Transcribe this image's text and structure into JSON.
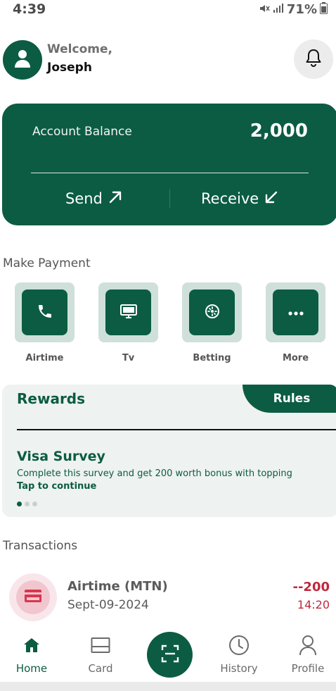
{
  "status_bar": {
    "time": "4:39",
    "battery": "71%"
  },
  "header": {
    "welcome": "Welcome,",
    "user_name": "Joseph"
  },
  "balance_card": {
    "label": "Account Balance",
    "value": "2,000",
    "send_label": "Send",
    "receive_label": "Receive"
  },
  "make_payment": {
    "title": "Make Payment",
    "items": [
      {
        "label": "Airtime",
        "icon": "phone-icon"
      },
      {
        "label": "Tv",
        "icon": "tv-icon"
      },
      {
        "label": "Betting",
        "icon": "betting-icon"
      },
      {
        "label": "More",
        "icon": "more-icon"
      }
    ]
  },
  "rewards": {
    "title": "Rewards",
    "rules_label": "Rules",
    "survey_title": "Visa Survey",
    "survey_description": "Complete this survey and get 200 worth bonus with topping",
    "survey_cta": "Tap to continue",
    "carousel_index": 1,
    "carousel_total": 3
  },
  "transactions": {
    "title": "Transactions",
    "items": [
      {
        "title": "Airtime (MTN)",
        "date": "Sept-09-2024",
        "amount": "--200",
        "time": "14:20"
      }
    ]
  },
  "bottom_nav": {
    "items": [
      {
        "label": "Home",
        "active": true
      },
      {
        "label": "Card",
        "active": false
      },
      {
        "label": "History",
        "active": false
      },
      {
        "label": "Profile",
        "active": false
      }
    ]
  },
  "colors": {
    "primary": "#0b5c42",
    "tile_bg": "#cfe0da",
    "negative": "#c0283d"
  }
}
